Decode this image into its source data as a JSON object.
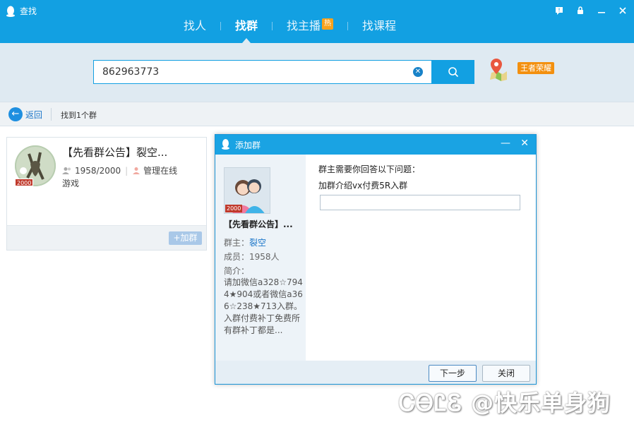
{
  "window": {
    "title": "查找"
  },
  "tabs": [
    {
      "label": "找人",
      "active": false
    },
    {
      "label": "找群",
      "active": true
    },
    {
      "label": "找主播",
      "active": false,
      "badge": "热"
    },
    {
      "label": "找课程",
      "active": false
    }
  ],
  "search": {
    "value": "862963773",
    "location_tag": "王者荣耀"
  },
  "results": {
    "back_label": "返回",
    "count_text": "找到1个群"
  },
  "group_card": {
    "name": "【先看群公告】裂空...",
    "members": "1958/2000",
    "admin_status": "管理在线",
    "tag": "游戏",
    "level_badge": "2000",
    "join_label": "+加群"
  },
  "dialog": {
    "title": "添加群",
    "group_name": "【先看群公告】...",
    "level_badge": "2000",
    "owner_label": "群主：",
    "owner_name": "裂空",
    "members_text": "成员：1958人",
    "intro_label": "简介：",
    "intro_text": "请加微信a328☆7944★904或者微信a366☆238★713入群。入群付费补丁免费所有群补丁都是...",
    "question_header": "群主需要你回答以下问题：",
    "question_text": "加群介绍vx付费5R入群",
    "answer_value": "",
    "next_label": "下一步",
    "close_label": "关闭"
  },
  "watermark": {
    "text": "ᏟᎾᏝᏋ @快乐单身狗"
  },
  "colors": {
    "header_blue": "#12a0e2",
    "search_band": "#dfeaf2",
    "link_blue": "#1e77c9",
    "hot_orange": "#f7a21c",
    "badge_red": "#c0392b"
  }
}
